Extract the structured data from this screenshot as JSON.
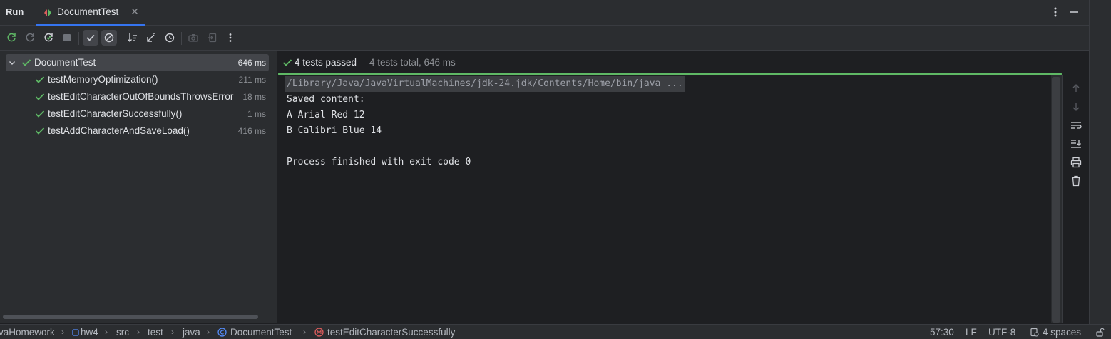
{
  "header": {
    "panel_title": "Run",
    "tab_label": "DocumentTest"
  },
  "toolbar": {
    "buttons": [
      "rerun-icon",
      "rerun-failed-icon",
      "toggle-auto-test-icon",
      "stop-icon",
      "show-passed-icon",
      "show-ignored-icon",
      "sort-icon",
      "collapse-icon",
      "history-icon",
      "screenshot-icon",
      "export-icon",
      "more-icon"
    ]
  },
  "tree": {
    "root": {
      "label": "DocumentTest",
      "time": "646 ms"
    },
    "items": [
      {
        "label": "testMemoryOptimization()",
        "time": "211 ms"
      },
      {
        "label": "testEditCharacterOutOfBoundsThrowsError",
        "time": "18 ms"
      },
      {
        "label": "testEditCharacterSuccessfully()",
        "time": "1 ms"
      },
      {
        "label": "testAddCharacterAndSaveLoad()",
        "time": "416 ms"
      }
    ]
  },
  "summary": {
    "passed": "4 tests passed",
    "total": "4 tests total, 646 ms"
  },
  "console": {
    "command": "/Library/Java/JavaVirtualMachines/jdk-24.jdk/Contents/Home/bin/java ...",
    "lines": [
      "Saved content:",
      "A Arial Red 12",
      "B Calibri Blue 14",
      "",
      "Process finished with exit code 0"
    ]
  },
  "breadcrumb": {
    "items": [
      "vaHomework",
      "hw4",
      "src",
      "test",
      "java",
      "DocumentTest",
      "testEditCharacterSuccessfully"
    ]
  },
  "statusbar": {
    "position": "57:30",
    "line_ending": "LF",
    "encoding": "UTF-8",
    "indent": "4 spaces"
  },
  "colors": {
    "success": "#5fb865",
    "accent": "#3574f0",
    "background": "#1e1f22",
    "panel": "#2b2d30"
  }
}
